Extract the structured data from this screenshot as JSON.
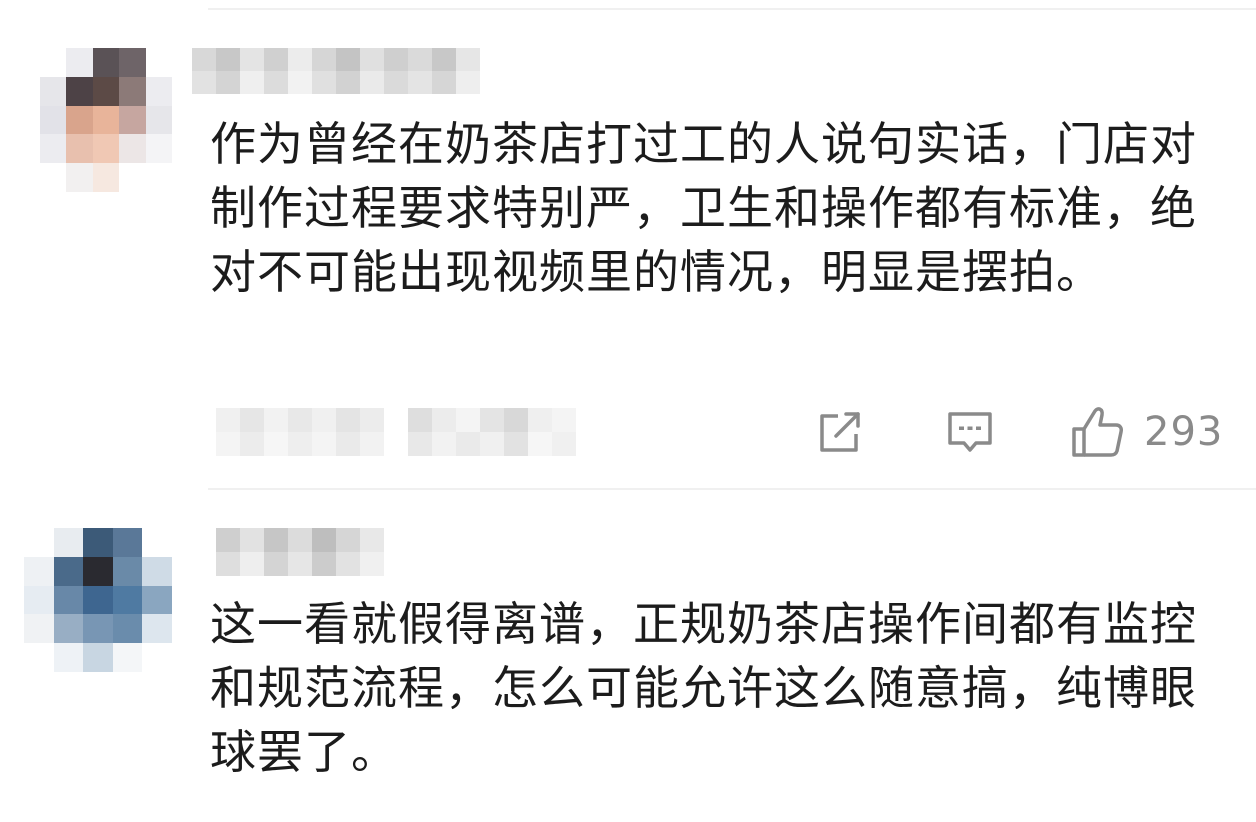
{
  "comments": [
    {
      "text": "作为曾经在奶茶店打过工的人说句实话，门店对制作过程要求特别严，卫生和操作都有标准，绝对不可能出现视频里的情况，明显是摆拍。",
      "like_count": "293",
      "avatar_icon": "blurred-avatar",
      "username_icon": "blurred-username"
    },
    {
      "text": "这一看就假得离谱，正规奶茶店操作间都有监控和规范流程，怎么可能允许这么随意搞，纯博眼球罢了。",
      "avatar_icon": "blurred-avatar",
      "username_icon": "blurred-username"
    }
  ],
  "actions": {
    "share_icon": "share-icon",
    "reply_icon": "comment-icon",
    "like_icon": "thumbs-up-icon"
  },
  "colors": {
    "text": "#1c1c1c",
    "icon": "#8a8a8a",
    "divider": "#f0f0f0"
  }
}
